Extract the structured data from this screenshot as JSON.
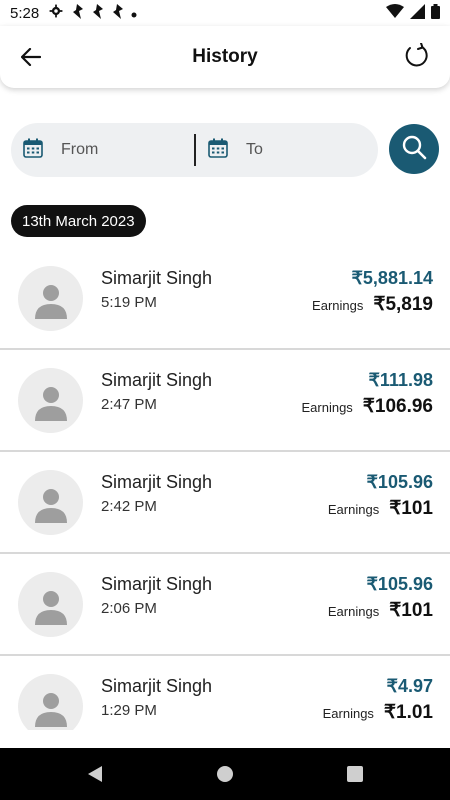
{
  "status_bar": {
    "time": "5:28"
  },
  "header": {
    "title": "History"
  },
  "filter": {
    "from_label": "From",
    "to_label": "To"
  },
  "date_group": "13th March 2023",
  "earnings_label": "Earnings",
  "transactions": [
    {
      "name": "Simarjit Singh",
      "time": "5:19 PM",
      "amount": "₹5,881.14",
      "earnings": "₹5,819"
    },
    {
      "name": "Simarjit Singh",
      "time": "2:47 PM",
      "amount": "₹111.98",
      "earnings": "₹106.96"
    },
    {
      "name": "Simarjit Singh",
      "time": "2:42 PM",
      "amount": "₹105.96",
      "earnings": "₹101"
    },
    {
      "name": "Simarjit Singh",
      "time": "2:06 PM",
      "amount": "₹105.96",
      "earnings": "₹101"
    },
    {
      "name": "Simarjit Singh",
      "time": "1:29 PM",
      "amount": "₹4.97",
      "earnings": "₹1.01"
    }
  ],
  "colors": {
    "accent": "#1a5a73",
    "chip": "#111111",
    "field_bg": "#eef0f2"
  },
  "icons": [
    "back-arrow-icon",
    "refresh-icon",
    "calendar-icon",
    "search-icon",
    "person-icon"
  ]
}
